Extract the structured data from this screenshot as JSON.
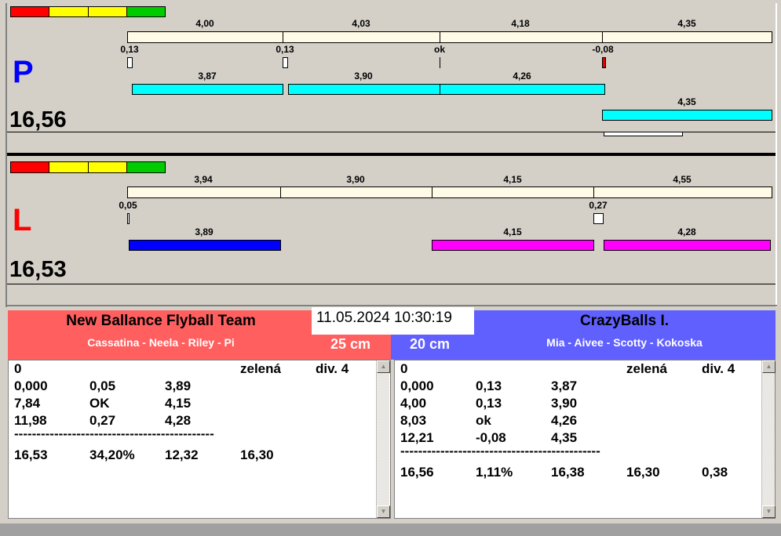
{
  "lanes": {
    "P": {
      "letter": "P",
      "color": "#0000ff",
      "total": "16,56",
      "splits": [
        "4,00",
        "4,03",
        "4,18",
        "4,35"
      ],
      "reactions": [
        "0,13",
        "0,13",
        "ok",
        "-0,08"
      ],
      "dog_times": [
        "3,87",
        "3,90",
        "4,26",
        "4,35"
      ]
    },
    "L": {
      "letter": "L",
      "color": "#ff0000",
      "total": "16,53",
      "splits": [
        "3,94",
        "3,90",
        "4,15",
        "4,55"
      ],
      "reactions": [
        "0,05",
        "0,27"
      ],
      "dog_times": [
        "3,89",
        "4,15",
        "4,28"
      ]
    }
  },
  "datetime": "11.05.2024 10:30:19",
  "left_team": {
    "name": "New Ballance Flyball Team",
    "dogs": "Cassatina - Neela - Riley - Pi",
    "height": "25 cm",
    "color": "#ff5f5f",
    "rows": [
      [
        "0",
        "",
        "",
        "zelená",
        "div. 4"
      ],
      [
        "0,000",
        "0,05",
        "3,89"
      ],
      [
        "7,84",
        "OK",
        "4,15"
      ],
      [
        "11,98",
        "0,27",
        "4,28"
      ]
    ],
    "separator": "---------------------------------------------",
    "summary": [
      "16,53",
      "34,20%",
      "12,32",
      "16,30"
    ]
  },
  "right_team": {
    "name": "CrazyBalls I.",
    "dogs": "Mia - Aivee - Scotty - Kokoska",
    "height": "20 cm",
    "color": "#6060ff",
    "rows": [
      [
        "0",
        "",
        "",
        "zelená",
        "div. 4"
      ],
      [
        "0,000",
        "0,13",
        "3,87"
      ],
      [
        "4,00",
        "0,13",
        "3,90"
      ],
      [
        "8,03",
        "ok",
        "4,26"
      ],
      [
        "12,21",
        "-0,08",
        "4,35"
      ]
    ],
    "separator": "---------------------------------------------",
    "summary": [
      "16,56",
      "1,11%",
      "16,38",
      "16,30",
      "0,38"
    ]
  }
}
